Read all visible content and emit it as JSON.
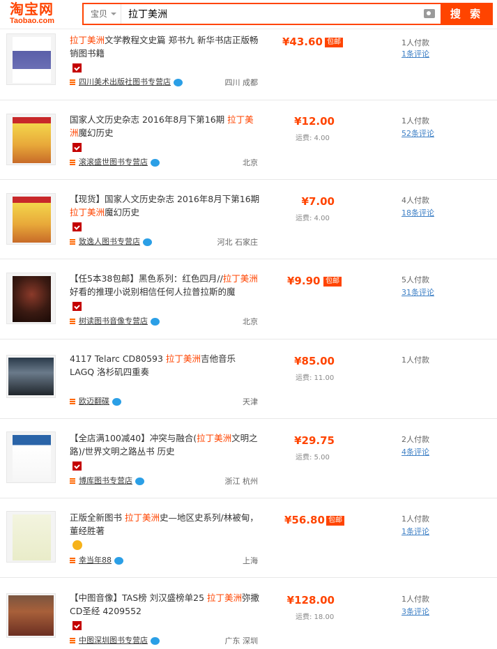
{
  "header": {
    "logo": "淘宝网",
    "logo_sub": "Taobao.com",
    "scope": "宝贝",
    "query": "拉丁美洲",
    "search_button": "搜 索"
  },
  "items": [
    {
      "title_pre": "",
      "title_hl": "拉丁美洲",
      "title_post": "文学教程文史篇 郑书九 新华书店正版畅销图书籍",
      "price": "¥43.60",
      "baoyou": "包邮",
      "shipping": "",
      "shop": "四川美术出版社图书专营店",
      "location": "四川 成都",
      "paid": "1人付款",
      "reviews": "1条评论"
    },
    {
      "title_pre": "国家人文历史杂志 2016年8月下第16期 ",
      "title_hl": "拉丁美洲",
      "title_post": "魔幻历史",
      "price": "¥12.00",
      "baoyou": "",
      "shipping": "运费: 4.00",
      "shop": "滚滚盛世图书专营店",
      "location": "北京",
      "paid": "1人付款",
      "reviews": "52条评论"
    },
    {
      "title_pre": "【现货】国家人文历史杂志 2016年8月下第16期 ",
      "title_hl": "拉丁美洲",
      "title_post": "魔幻历史",
      "price": "¥7.00",
      "baoyou": "",
      "shipping": "运费: 4.00",
      "shop": "致逸人图书专营店",
      "location": "河北 石家庄",
      "paid": "4人付款",
      "reviews": "18条评论"
    },
    {
      "title_pre": "【任5本38包邮】黑色系列：红色四月//",
      "title_hl": "拉丁美洲",
      "title_post": "好看的推理小说别相信任何人拉普拉斯的魔",
      "price": "¥9.90",
      "baoyou": "包邮",
      "shipping": "",
      "shop": "树读图书音像专营店",
      "location": "北京",
      "paid": "5人付款",
      "reviews": "31条评论"
    },
    {
      "title_pre": "4117 Telarc CD80593 ",
      "title_hl": "拉丁美洲",
      "title_post": "吉他音乐 LAGQ 洛杉矶四重奏",
      "price": "¥85.00",
      "baoyou": "",
      "shipping": "运费: 11.00",
      "shop": "欧迈翻碟",
      "location": "天津",
      "paid": "1人付款",
      "reviews": ""
    },
    {
      "title_pre": "【全店满100减40】冲突与融合(",
      "title_hl": "拉丁美洲",
      "title_post": "文明之路)/世界文明之路丛书 历史",
      "price": "¥29.75",
      "baoyou": "",
      "shipping": "运费: 5.00",
      "shop": "博库图书专营店",
      "location": "浙江 杭州",
      "paid": "2人付款",
      "reviews": "4条评论"
    },
    {
      "title_pre": "正版全新图书 ",
      "title_hl": "拉丁美洲",
      "title_post": "史—地区史系列/林被甸，董经胜著",
      "price": "¥56.80",
      "baoyou": "包邮",
      "shipping": "",
      "shop": "幸当年88",
      "location": "上海",
      "paid": "1人付款",
      "reviews": "1条评论"
    },
    {
      "title_pre": "【中图音像】TAS榜 刘汉盛榜单25 ",
      "title_hl": "拉丁美洲",
      "title_post": "弥撒 CD圣经 4209552",
      "price": "¥128.00",
      "baoyou": "",
      "shipping": "运费: 18.00",
      "shop": "中图深圳图书专营店",
      "location": "广东 深圳",
      "paid": "1人付款",
      "reviews": "3条评论"
    }
  ]
}
